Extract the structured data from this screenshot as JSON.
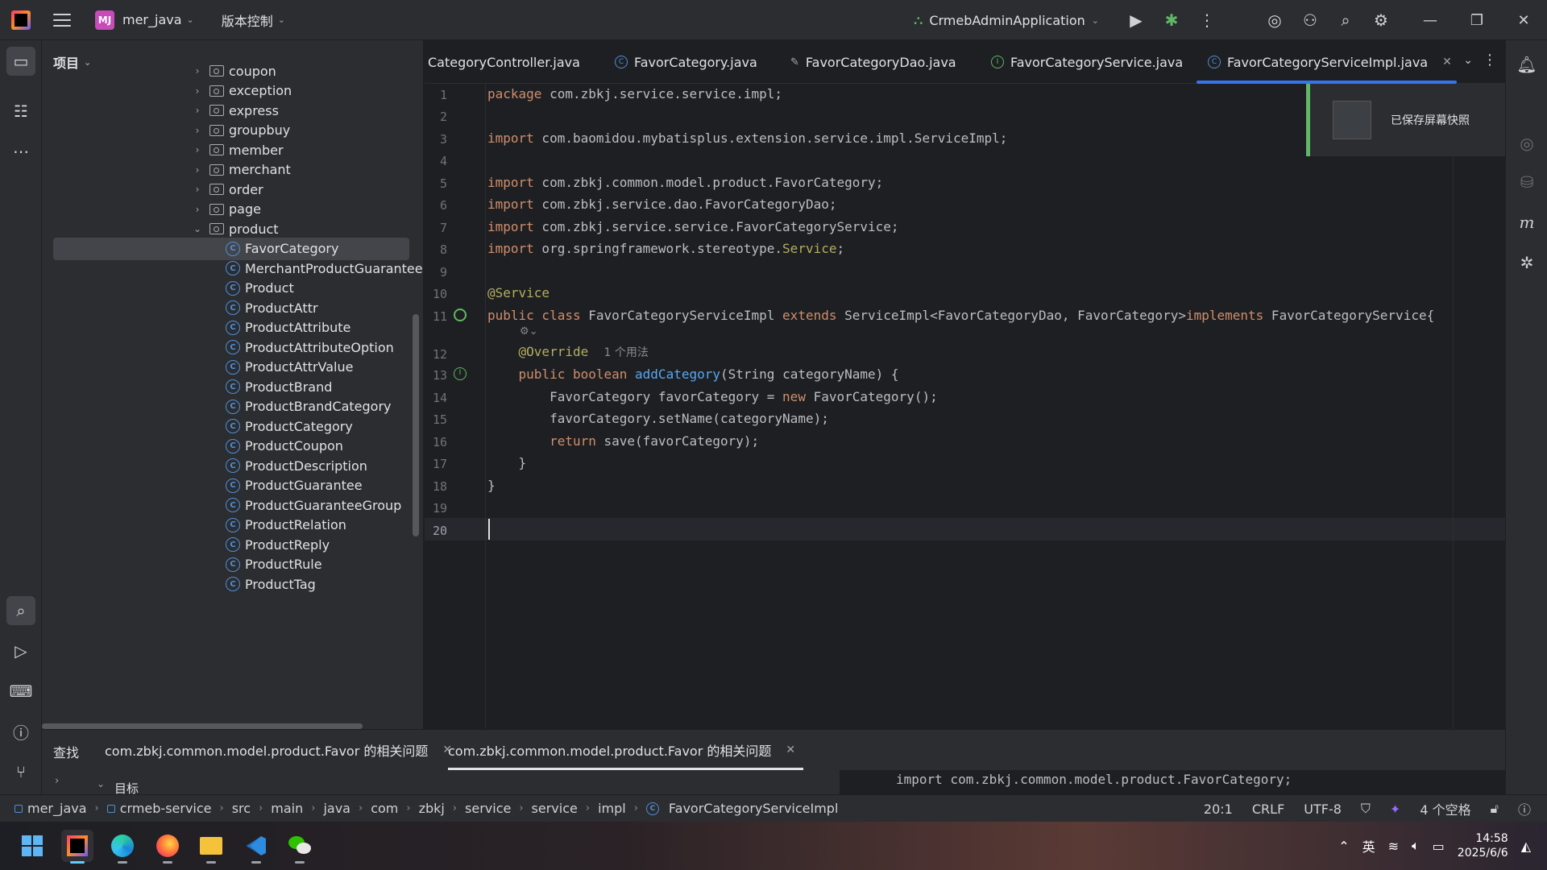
{
  "titlebar": {
    "project_badge": "MJ",
    "project_name": "mer_java",
    "vcs_menu": "版本控制",
    "run_config": "CrmebAdminApplication"
  },
  "project_panel": {
    "title": "项目",
    "items": [
      {
        "label": "coupon",
        "type": "folder",
        "expanded": false
      },
      {
        "label": "exception",
        "type": "folder",
        "expanded": false
      },
      {
        "label": "express",
        "type": "folder",
        "expanded": false
      },
      {
        "label": "groupbuy",
        "type": "folder",
        "expanded": false
      },
      {
        "label": "member",
        "type": "folder",
        "expanded": false
      },
      {
        "label": "merchant",
        "type": "folder",
        "expanded": false
      },
      {
        "label": "order",
        "type": "folder",
        "expanded": false
      },
      {
        "label": "page",
        "type": "folder",
        "expanded": false
      },
      {
        "label": "product",
        "type": "folder",
        "expanded": true
      },
      {
        "label": "FavorCategory",
        "type": "class",
        "selected": true
      },
      {
        "label": "MerchantProductGuaranteeGr",
        "type": "class"
      },
      {
        "label": "Product",
        "type": "class"
      },
      {
        "label": "ProductAttr",
        "type": "class"
      },
      {
        "label": "ProductAttribute",
        "type": "class"
      },
      {
        "label": "ProductAttributeOption",
        "type": "class"
      },
      {
        "label": "ProductAttrValue",
        "type": "class"
      },
      {
        "label": "ProductBrand",
        "type": "class"
      },
      {
        "label": "ProductBrandCategory",
        "type": "class"
      },
      {
        "label": "ProductCategory",
        "type": "class"
      },
      {
        "label": "ProductCoupon",
        "type": "class"
      },
      {
        "label": "ProductDescription",
        "type": "class"
      },
      {
        "label": "ProductGuarantee",
        "type": "class"
      },
      {
        "label": "ProductGuaranteeGroup",
        "type": "class"
      },
      {
        "label": "ProductRelation",
        "type": "class"
      },
      {
        "label": "ProductReply",
        "type": "class"
      },
      {
        "label": "ProductRule",
        "type": "class"
      },
      {
        "label": "ProductTag",
        "type": "class"
      }
    ]
  },
  "tabs": [
    {
      "label": "CategoryController.java",
      "icon": "class-icon"
    },
    {
      "label": "FavorCategory.java",
      "icon": "class-icon"
    },
    {
      "label": "FavorCategoryDao.java",
      "icon": "dao-icon"
    },
    {
      "label": "FavorCategoryService.java",
      "icon": "interface-icon"
    },
    {
      "label": "FavorCategoryServiceImpl.java",
      "icon": "class-icon",
      "active": true
    }
  ],
  "editor": {
    "line_numbers": [
      "1",
      "2",
      "3",
      "4",
      "5",
      "6",
      "7",
      "8",
      "9",
      "10",
      "11",
      "12",
      "13",
      "14",
      "15",
      "16",
      "17",
      "18",
      "19",
      "20"
    ],
    "usage_hint": "1 个用法",
    "cursor_line": "20"
  },
  "notification": {
    "message": "已保存屏幕快照"
  },
  "find_panel": {
    "title": "查找",
    "tabs": [
      {
        "label": "com.zbkj.common.model.product.Favor 的相关问题"
      },
      {
        "label": "com.zbkj.common.model.product.Favor 的相关问题",
        "active": true
      }
    ],
    "tree_label": "目标",
    "preview_text": "import com.zbkj.common.model.product.FavorCategory;"
  },
  "statusbar": {
    "breadcrumb": [
      "mer_java",
      "crmeb-service",
      "src",
      "main",
      "java",
      "com",
      "zbkj",
      "service",
      "service",
      "impl",
      "FavorCategoryServiceImpl"
    ],
    "position": "20:1",
    "line_sep": "CRLF",
    "encoding": "UTF-8",
    "indent": "4 个空格"
  },
  "taskbar": {
    "ime": "英",
    "time": "14:58",
    "date": "2025/6/6"
  },
  "colors": {
    "accent": "#3574f0",
    "keyword": "#cf8e6d",
    "annotation": "#b3ae60",
    "method": "#56a8f5",
    "toast_bar": "#5fb865"
  }
}
